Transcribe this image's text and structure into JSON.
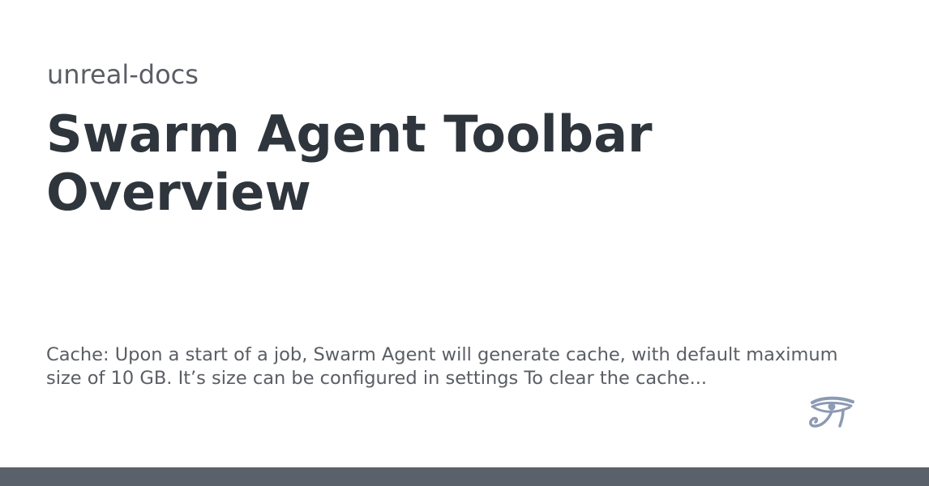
{
  "card": {
    "site_name": "unreal-docs",
    "title": "Swarm Agent Toolbar Overview",
    "description": "Cache: Upon a start of a job, Swarm Agent will generate cache, with default maximum size of 10 GB. It’s size can be configured in settings To clear the cache...",
    "logo_icon": "eye-of-horus-icon",
    "colors": {
      "title": "#2f353c",
      "muted_text": "#5a5e64",
      "logo": "#8c9ab3",
      "bottom_bar": "#5b616b"
    }
  }
}
